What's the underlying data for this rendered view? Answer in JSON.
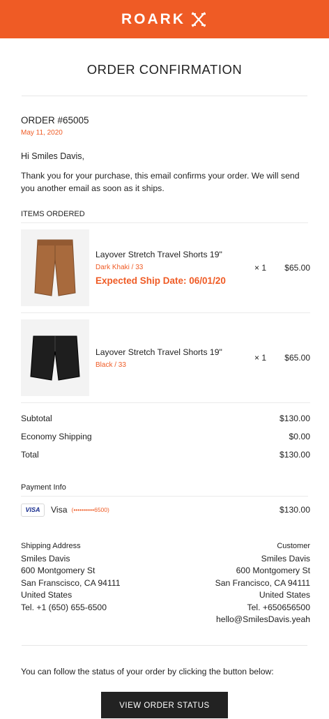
{
  "brand": {
    "name": "ROARK",
    "accent": "#ef5b25"
  },
  "title": "ORDER CONFIRMATION",
  "order": {
    "number": "ORDER #65005",
    "date": "May 11, 2020"
  },
  "greeting": "Hi Smiles Davis,",
  "intro": "Thank you for your purchase, this email confirms your order. We will send you another email as soon as it ships.",
  "items_label": "ITEMS ORDERED",
  "items": [
    {
      "name": "Layover Stretch Travel Shorts 19\"",
      "variant": "Dark Khaki / 33",
      "ship": "Expected Ship Date: 06/01/20",
      "qty": "× 1",
      "price": "$65.00",
      "color": "#a86a3d"
    },
    {
      "name": "Layover Stretch Travel Shorts 19\"",
      "variant": "Black / 33",
      "ship": "",
      "qty": "× 1",
      "price": "$65.00",
      "color": "#1e1e1e"
    }
  ],
  "totals": [
    {
      "label": "Subtotal",
      "value": "$130.00"
    },
    {
      "label": "Economy Shipping",
      "value": "$0.00"
    },
    {
      "label": "Total",
      "value": "$130.00"
    }
  ],
  "payment": {
    "label": "Payment Info",
    "badge": "VISA",
    "method": "Visa",
    "card": "(••••••••••6500)",
    "amount": "$130.00"
  },
  "shipping": {
    "heading": "Shipping Address",
    "lines": [
      "Smiles Davis",
      "600 Montgomery St",
      "San Franscisco, CA 94111",
      "United States",
      "Tel. +1 (650) 655-6500"
    ]
  },
  "customer": {
    "heading": "Customer",
    "lines": [
      "Smiles Davis",
      "600 Montgomery St",
      "San Francisco, CA 94111",
      "United States",
      "Tel. +650656500",
      "hello@SmilesDavis.yeah"
    ]
  },
  "follow_text": "You can follow the status of your order by clicking the button below:",
  "button_label": "VIEW ORDER STATUS"
}
